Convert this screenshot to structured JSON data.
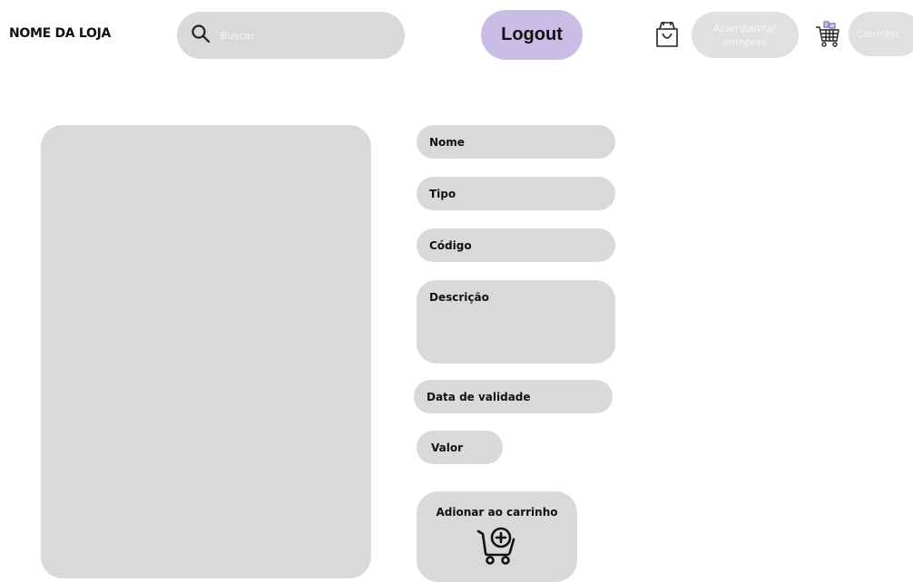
{
  "header": {
    "store_name": "NOME DA LOJA",
    "search_placeholder": "Buscar",
    "logout_label": "Logout",
    "track_orders_label": "Acompanhar compras",
    "cart_label": "Carrinho"
  },
  "product": {
    "fields": {
      "name": "Nome",
      "type": "Tipo",
      "code": "Código",
      "description": "Descrição",
      "expiry_date": "Data de validade",
      "price": "Valor"
    },
    "add_to_cart_label": "Adionar ao carrinho"
  },
  "colors": {
    "field_background": "#d9d9d9",
    "logout_background": "#c9bde6",
    "faded_button_background": "#e0e0e0"
  },
  "icons": [
    "search-icon",
    "shopping-bag-icon",
    "cart-icon",
    "add-to-cart-icon"
  ]
}
